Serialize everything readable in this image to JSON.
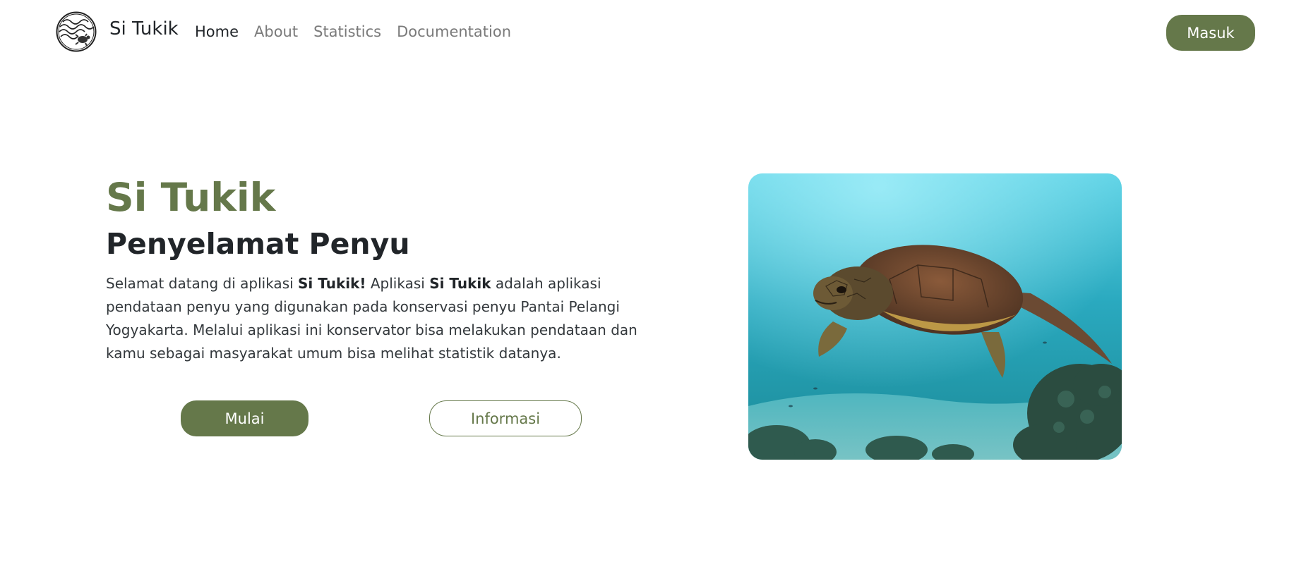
{
  "navbar": {
    "brand": "Si Tukik",
    "links": [
      {
        "label": "Home",
        "active": true
      },
      {
        "label": "About",
        "active": false
      },
      {
        "label": "Statistics",
        "active": false
      },
      {
        "label": "Documentation",
        "active": false
      }
    ],
    "login_label": "Masuk"
  },
  "hero": {
    "title": "Si Tukik",
    "subtitle": "Penyelamat Penyu",
    "text": {
      "p1": "Selamat datang di aplikasi ",
      "b1": "Si Tukik!",
      "p2": " Aplikasi ",
      "b2": "Si Tukik",
      "p3": " adalah aplikasi pendataan penyu yang digunakan pada konservasi penyu Pantai Pelangi Yogyakarta. Melalui aplikasi ini konservator bisa melakukan pendataan dan kamu sebagai masyarakat umum bisa melihat statistik datanya."
    },
    "start_label": "Mulai",
    "info_label": "Informasi"
  },
  "colors": {
    "accent": "#65784a",
    "text": "#212529",
    "muted": "#7a7a7a"
  },
  "icons": {
    "logo": "turtle-logo-icon",
    "image": "sea-turtle-photo"
  }
}
